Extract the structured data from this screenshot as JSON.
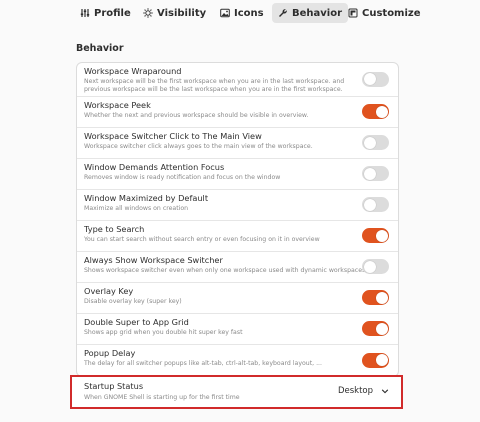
{
  "tabs": [
    {
      "label": "Profile",
      "icon": "sliders-icon",
      "active": false
    },
    {
      "label": "Visibility",
      "icon": "sun-icon",
      "active": false
    },
    {
      "label": "Icons",
      "icon": "image-icon",
      "active": false
    },
    {
      "label": "Behavior",
      "icon": "wrench-icon",
      "active": true
    },
    {
      "label": "Customize",
      "icon": "brush-icon",
      "active": false
    }
  ],
  "section_title": "Behavior",
  "settings": [
    {
      "title": "Workspace Wraparound",
      "subtitle": "Next workspace will be the first workspace when you are in the last workspace. and previous workspace will be the last workspace when you are in the first workspace.",
      "on": false
    },
    {
      "title": "Workspace Peek",
      "subtitle": "Whether the next and previous workspace should be visible in overview.",
      "on": true
    },
    {
      "title": "Workspace Switcher Click to The Main View",
      "subtitle": "Workspace switcher click always goes to the main view of the workspace.",
      "on": false
    },
    {
      "title": "Window Demands Attention Focus",
      "subtitle": "Removes window is ready notification and focus on the window",
      "on": false
    },
    {
      "title": "Window Maximized by Default",
      "subtitle": "Maximize all windows on creation",
      "on": false
    },
    {
      "title": "Type to Search",
      "subtitle": "You can start search without search entry or even focusing on it in overview",
      "on": true
    },
    {
      "title": "Always Show Workspace Switcher",
      "subtitle": "Shows workspace switcher even when only one workspace used with dynamic workspaces",
      "on": false
    },
    {
      "title": "Overlay Key",
      "subtitle": "Disable overlay key (super key)",
      "on": true
    },
    {
      "title": "Double Super to App Grid",
      "subtitle": "Shows app grid when you double hit super key fast",
      "on": true
    },
    {
      "title": "Popup Delay",
      "subtitle": "The delay for all switcher popups like alt-tab, ctrl-alt-tab, keyboard layout, ...",
      "on": true
    }
  ],
  "startup": {
    "title": "Startup Status",
    "subtitle": "When GNOME Shell is starting up for the first time",
    "value": "Desktop"
  },
  "colors": {
    "accent": "#e0531f",
    "highlight_border": "#d12b2b"
  }
}
